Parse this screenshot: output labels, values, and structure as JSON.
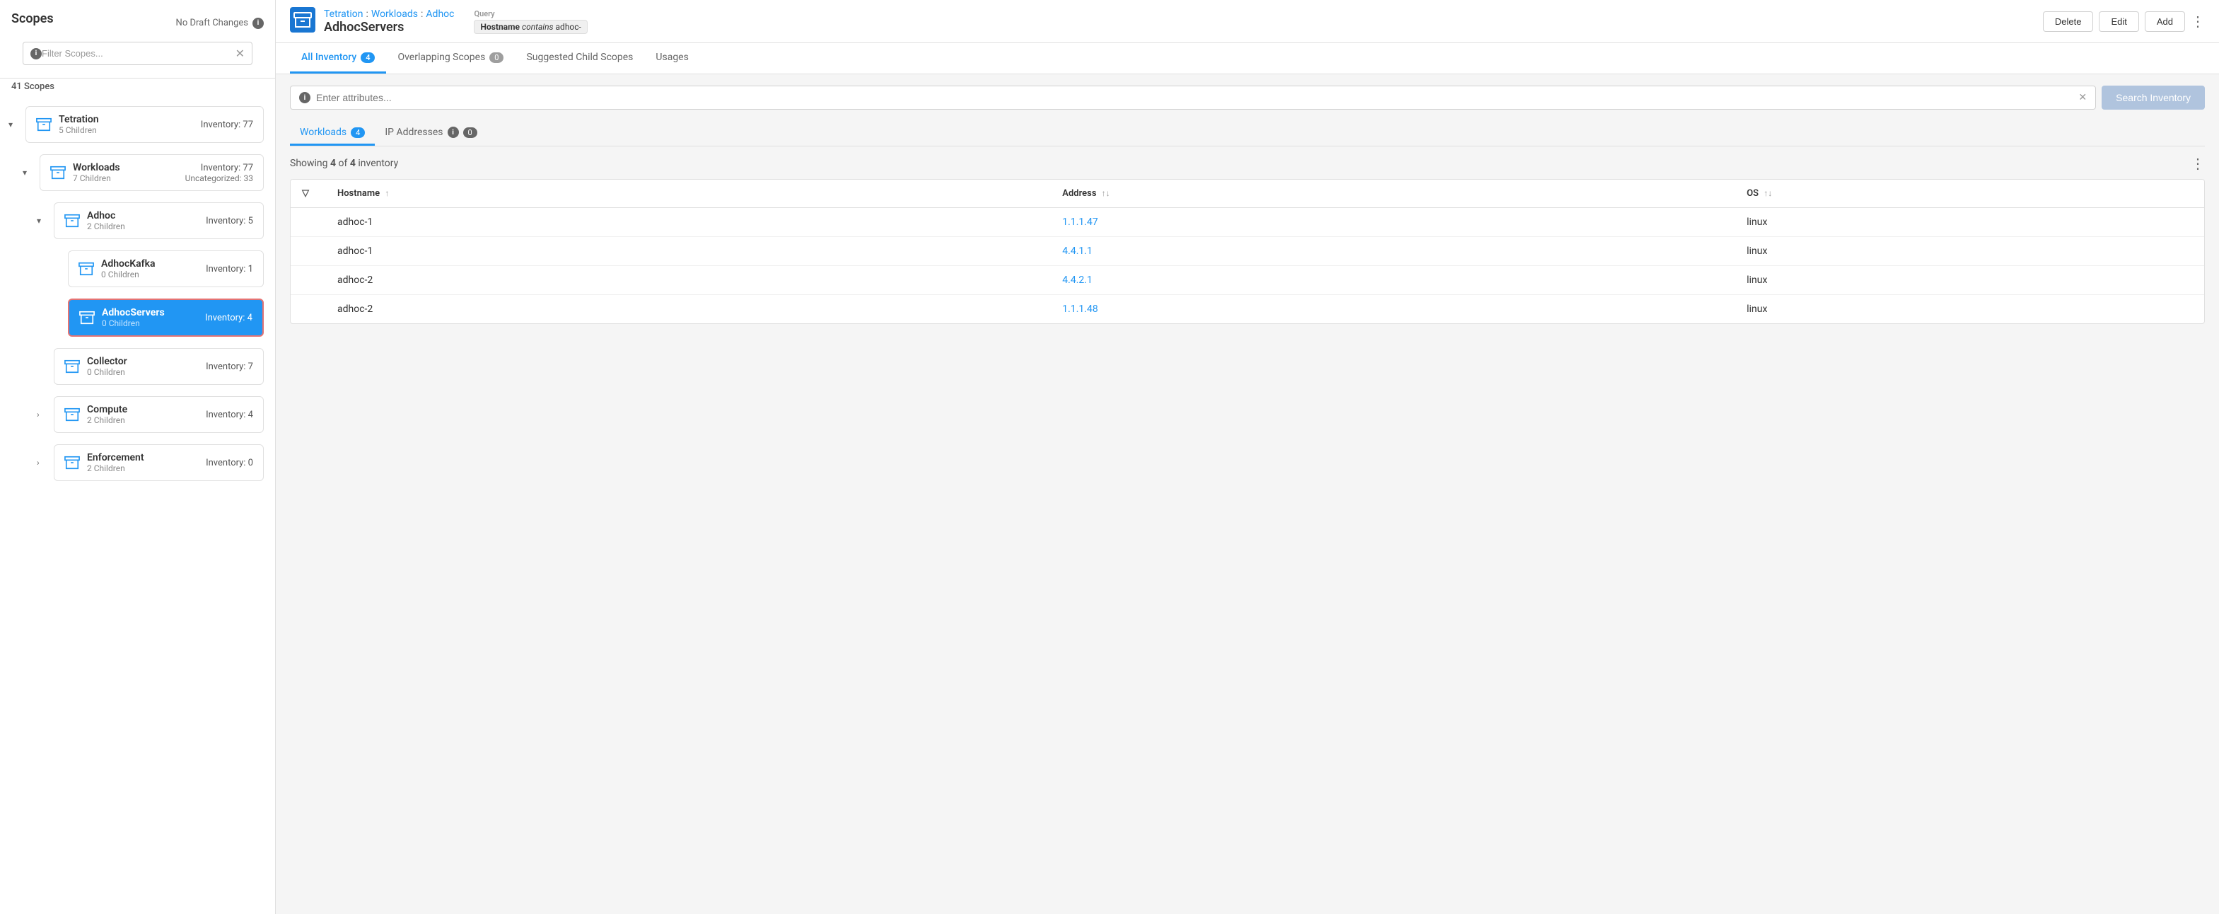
{
  "sidebar": {
    "title": "Scopes",
    "draft_notice": "No Draft Changes",
    "filter_placeholder": "Filter Scopes...",
    "scope_count": "41 Scopes",
    "scopes": [
      {
        "id": "tetration",
        "name": "Tetration",
        "children_count": "5 Children",
        "inventory": "Inventory: 77",
        "expanded": true,
        "level": 0,
        "has_children": true,
        "icon": "cube"
      },
      {
        "id": "workloads",
        "name": "Workloads",
        "children_count": "7 Children",
        "inventory": "Inventory: 77",
        "uncategorized": "Uncategorized: 33",
        "expanded": true,
        "level": 1,
        "has_children": true,
        "icon": "cube"
      },
      {
        "id": "adhoc",
        "name": "Adhoc",
        "children_count": "2 Children",
        "inventory": "Inventory: 5",
        "expanded": true,
        "level": 2,
        "has_children": true,
        "icon": "cube"
      },
      {
        "id": "adhockafka",
        "name": "AdhocKafka",
        "children_count": "0 Children",
        "inventory": "Inventory: 1",
        "level": 3,
        "has_children": false,
        "icon": "cube"
      },
      {
        "id": "adhocservers",
        "name": "AdhocServers",
        "children_count": "0 Children",
        "inventory": "Inventory: 4",
        "level": 3,
        "has_children": false,
        "icon": "cube",
        "active": true
      },
      {
        "id": "collector",
        "name": "Collector",
        "children_count": "0 Children",
        "inventory": "Inventory: 7",
        "level": 2,
        "has_children": false,
        "icon": "cube"
      },
      {
        "id": "compute",
        "name": "Compute",
        "children_count": "2 Children",
        "inventory": "Inventory: 4",
        "level": 2,
        "has_children": true,
        "icon": "cube"
      },
      {
        "id": "enforcement",
        "name": "Enforcement",
        "children_count": "2 Children",
        "inventory": "Inventory: 0",
        "level": 2,
        "has_children": true,
        "icon": "cube"
      }
    ]
  },
  "topbar": {
    "breadcrumb": [
      "Tetration",
      "Workloads",
      "Adhoc"
    ],
    "scope_title": "AdhocServers",
    "query_label": "Query",
    "query_text": "Hostname contains adhoc-",
    "buttons": {
      "delete": "Delete",
      "edit": "Edit",
      "add": "Add"
    }
  },
  "tabs": [
    {
      "id": "all-inventory",
      "label": "All Inventory",
      "badge": "4",
      "active": true
    },
    {
      "id": "overlapping-scopes",
      "label": "Overlapping Scopes",
      "badge": "0",
      "badge_style": "gray",
      "active": false
    },
    {
      "id": "suggested-child-scopes",
      "label": "Suggested Child Scopes",
      "badge": null,
      "active": false
    },
    {
      "id": "usages",
      "label": "Usages",
      "badge": null,
      "active": false
    }
  ],
  "content": {
    "search_placeholder": "Enter attributes...",
    "search_button": "Search Inventory",
    "sub_tabs": [
      {
        "id": "workloads",
        "label": "Workloads",
        "badge": "4",
        "active": true
      },
      {
        "id": "ip-addresses",
        "label": "IP Addresses",
        "badge": "0",
        "badge_style": "info",
        "active": false
      }
    ],
    "showing_text": "Showing",
    "showing_count": "4",
    "showing_total": "4",
    "showing_suffix": "inventory",
    "table": {
      "columns": [
        {
          "id": "filter",
          "label": "",
          "sortable": false
        },
        {
          "id": "hostname",
          "label": "Hostname",
          "sort": "↑"
        },
        {
          "id": "address",
          "label": "Address",
          "sort": "↑↓"
        },
        {
          "id": "os",
          "label": "OS",
          "sort": "↑↓"
        }
      ],
      "rows": [
        {
          "hostname": "adhoc-1",
          "address": "1.1.1.47",
          "os": "linux"
        },
        {
          "hostname": "adhoc-1",
          "address": "4.4.1.1",
          "os": "linux"
        },
        {
          "hostname": "adhoc-2",
          "address": "4.4.2.1",
          "os": "linux"
        },
        {
          "hostname": "adhoc-2",
          "address": "1.1.1.48",
          "os": "linux"
        }
      ]
    }
  }
}
